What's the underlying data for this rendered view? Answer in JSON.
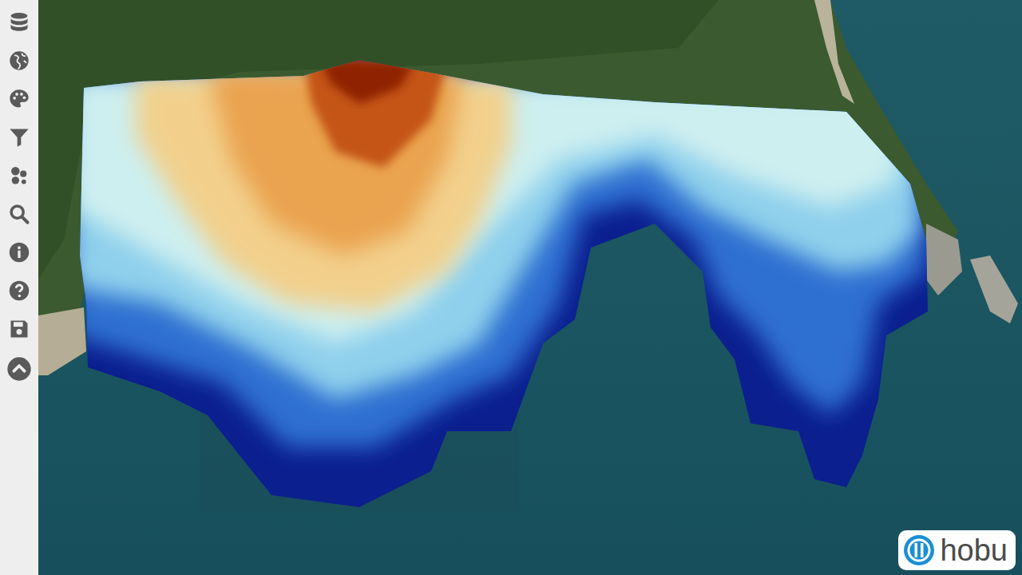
{
  "logo": {
    "text": "hobu"
  }
}
